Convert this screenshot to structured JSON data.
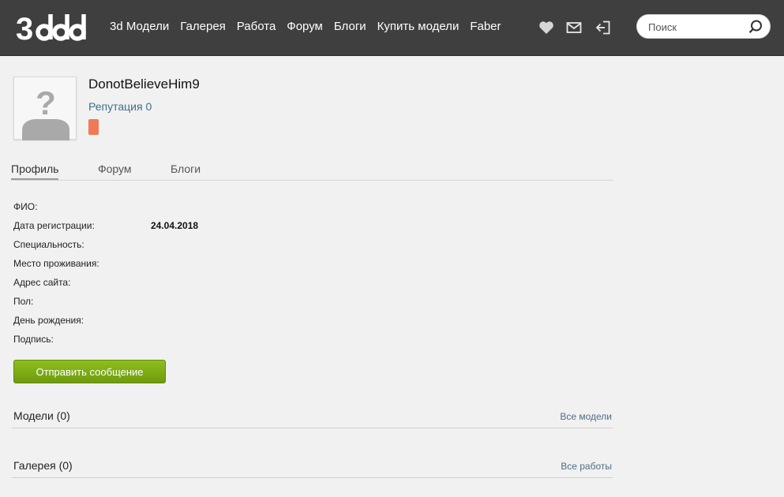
{
  "header": {
    "logo_text": "3ddd",
    "nav": [
      "3d Модели",
      "Галерея",
      "Работа",
      "Форум",
      "Блоги",
      "Купить модели",
      "Faber"
    ],
    "search_placeholder": "Поиск",
    "icons": [
      "heart-icon",
      "mail-icon",
      "login-icon",
      "search-icon"
    ]
  },
  "profile": {
    "username": "DonotBelieveHim9",
    "reputation": "Репутация 0",
    "badge_color": "#f07a55"
  },
  "tabs": [
    {
      "label": "Профиль",
      "active": true
    },
    {
      "label": "Форум",
      "active": false
    },
    {
      "label": "Блоги",
      "active": false
    }
  ],
  "info": [
    {
      "label": "ФИО:",
      "value": ""
    },
    {
      "label": "Дата регистрации:",
      "value": "24.04.2018"
    },
    {
      "label": "Специальность:",
      "value": ""
    },
    {
      "label": "Место проживания:",
      "value": ""
    },
    {
      "label": "Адрес сайта:",
      "value": ""
    },
    {
      "label": "Пол:",
      "value": ""
    },
    {
      "label": "День рождения:",
      "value": ""
    },
    {
      "label": "Подпись:",
      "value": ""
    }
  ],
  "send_button": "Отправить сообщение",
  "sections": [
    {
      "title": "Модели (0)",
      "link": "Все модели"
    },
    {
      "title": "Галерея (0)",
      "link": "Все работы"
    }
  ],
  "colors": {
    "header_bg": "#3f3f3f",
    "page_bg": "#f1f1f1",
    "link": "#3b6f8f",
    "button_green": "#7aa814"
  }
}
